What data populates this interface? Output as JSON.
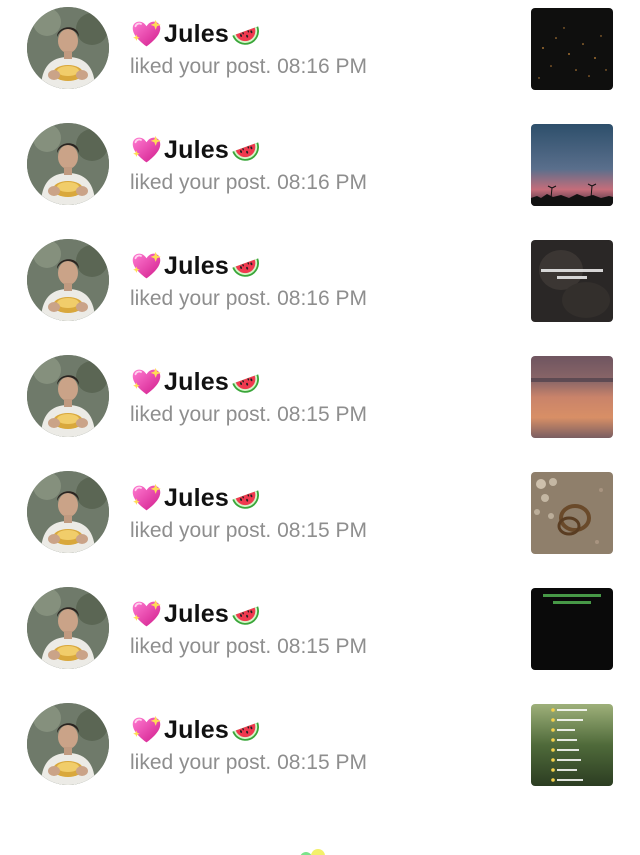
{
  "notifications": [
    {
      "emoji_left": "sparkling-heart-icon",
      "user": "Jules",
      "emoji_right": "watermelon-icon",
      "action": "liked your post.",
      "time": "08:16 PM",
      "post_theme": "dark-starry"
    },
    {
      "emoji_left": "sparkling-heart-icon",
      "user": "Jules",
      "emoji_right": "watermelon-icon",
      "action": "liked your post.",
      "time": "08:16 PM",
      "post_theme": "sunset-palms"
    },
    {
      "emoji_left": "sparkling-heart-icon",
      "user": "Jules",
      "emoji_right": "watermelon-icon",
      "action": "liked your post.",
      "time": "08:16 PM",
      "post_theme": "dark-text"
    },
    {
      "emoji_left": "sparkling-heart-icon",
      "user": "Jules",
      "emoji_right": "watermelon-icon",
      "action": "liked your post.",
      "time": "08:15 PM",
      "post_theme": "ocean-sunset"
    },
    {
      "emoji_left": "sparkling-heart-icon",
      "user": "Jules",
      "emoji_right": "watermelon-icon",
      "action": "liked your post.",
      "time": "08:15 PM",
      "post_theme": "rings-bokeh"
    },
    {
      "emoji_left": "sparkling-heart-icon",
      "user": "Jules",
      "emoji_right": "watermelon-icon",
      "action": "liked your post.",
      "time": "08:15 PM",
      "post_theme": "green-text-black"
    },
    {
      "emoji_left": "sparkling-heart-icon",
      "user": "Jules",
      "emoji_right": "watermelon-icon",
      "action": "liked your post.",
      "time": "08:15 PM",
      "post_theme": "checklist-field"
    }
  ],
  "colors": {
    "name": "#111111",
    "secondary_text": "#8e8e8e",
    "background": "#ffffff"
  },
  "loading_indicator": "loading-spinner-icon"
}
